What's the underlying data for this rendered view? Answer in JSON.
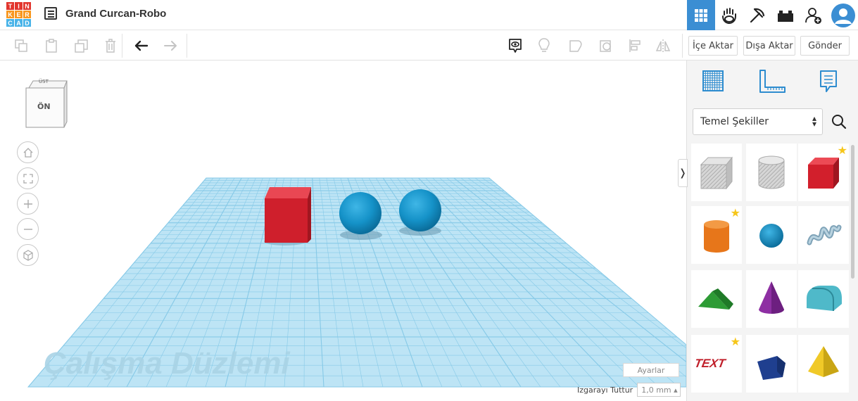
{
  "app": {
    "title": "Grand Curcan-Robo",
    "logo_letters": [
      "T",
      "I",
      "N",
      "K",
      "E",
      "R",
      "C",
      "A",
      "D"
    ],
    "logo_colors": [
      "#e2352d",
      "#e2352d",
      "#e2352d",
      "#f8961d",
      "#f8961d",
      "#f8961d",
      "#48b3e8",
      "#48b3e8",
      "#48b3e8"
    ]
  },
  "topbar": {
    "icons": [
      "grid-view-icon",
      "tinker-hand-icon",
      "pickaxe-icon",
      "bricks-icon",
      "add-user-icon",
      "user-avatar-icon"
    ],
    "active": "grid-view-icon"
  },
  "toolbar": {
    "import_label": "İçe Aktar",
    "export_label": "Dışa Aktar",
    "send_label": "Gönder"
  },
  "viewcube": {
    "top_label": "ÜST",
    "front_label": "ÖN"
  },
  "workplane": {
    "watermark": "Çalışma Düzlemi",
    "settings_label": "Ayarlar",
    "snap_label": "Izgarayı Tuttur",
    "snap_value": "1,0 mm ▴",
    "objects": [
      "red-box",
      "blue-sphere",
      "blue-sphere"
    ]
  },
  "panel": {
    "category": "Temel Şekiller",
    "shapes": [
      {
        "name": "box-hole",
        "starred": false
      },
      {
        "name": "cylinder-hole",
        "starred": false
      },
      {
        "name": "box",
        "starred": true
      },
      {
        "name": "cylinder",
        "starred": true
      },
      {
        "name": "sphere",
        "starred": false
      },
      {
        "name": "scribble",
        "starred": false
      },
      {
        "name": "roof",
        "starred": false
      },
      {
        "name": "cone",
        "starred": false
      },
      {
        "name": "round-roof",
        "starred": false
      },
      {
        "name": "text",
        "starred": true
      },
      {
        "name": "polygon",
        "starred": false
      },
      {
        "name": "pyramid",
        "starred": false
      }
    ],
    "star_glyph": "★"
  },
  "colors": {
    "accent": "#3b8ed3",
    "grid": "#b8e2f4",
    "grid_line": "#7cc4e6",
    "box_red": "#d2202c",
    "sphere_blue": "#1391c9"
  }
}
